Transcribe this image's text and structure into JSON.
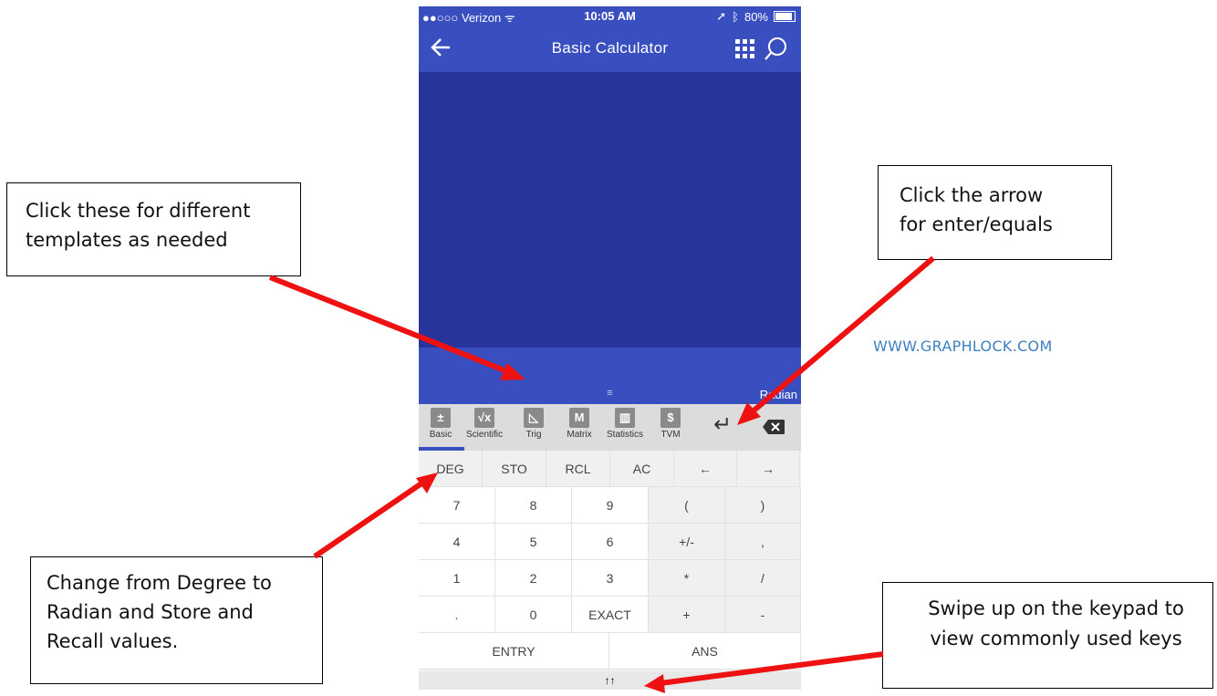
{
  "status_bar": {
    "carrier": "●●○○○ Verizon ᯤ",
    "time": "10:05 AM",
    "battery_text": "80%",
    "battery_level": 0.8
  },
  "nav": {
    "title": "Basic Calculator"
  },
  "entry": {
    "mode": "Radian",
    "handle": "≡"
  },
  "templates": [
    {
      "label": "Basic",
      "icon": "basic-icon",
      "glyph": "±"
    },
    {
      "label": "Scientific",
      "icon": "sqrt-icon",
      "glyph": "√x"
    },
    {
      "label": "Trig",
      "icon": "triangle-icon",
      "glyph": "◺"
    },
    {
      "label": "Matrix",
      "icon": "matrix-icon",
      "glyph": "M"
    },
    {
      "label": "Statistics",
      "icon": "chart-icon",
      "glyph": "▥"
    },
    {
      "label": "TVM",
      "icon": "money-calc-icon",
      "glyph": "$"
    }
  ],
  "toolbar": {
    "enter": "↵"
  },
  "keypad": {
    "row1": [
      "DEG",
      "STO",
      "RCL",
      "AC",
      "←",
      "→"
    ],
    "row2": [
      "7",
      "8",
      "9",
      "(",
      ")"
    ],
    "row3": [
      "4",
      "5",
      "6",
      "+/-",
      ","
    ],
    "row4": [
      "1",
      "2",
      "3",
      "*",
      "/"
    ],
    "row5": [
      ".",
      "0",
      "EXACT",
      "+",
      "-"
    ],
    "row6": [
      "ENTRY",
      "ANS"
    ]
  },
  "swipe_hint": "↑↑",
  "annotations": {
    "templates": [
      "Click these for different",
      "templates as needed"
    ],
    "arrow": [
      "Click the arrow",
      "for enter/equals"
    ],
    "degree": [
      "Change from Degree to",
      "Radian and Store and",
      "Recall values."
    ],
    "swipe": [
      "Swipe up on the keypad to",
      "view commonly used keys"
    ]
  },
  "watermark": "WWW.GRAPHLOCK.COM",
  "colors": {
    "header": "#3a4fbf",
    "display": "#27359a",
    "arrow": "#ee1111",
    "watermark": "#3f7fc0"
  }
}
